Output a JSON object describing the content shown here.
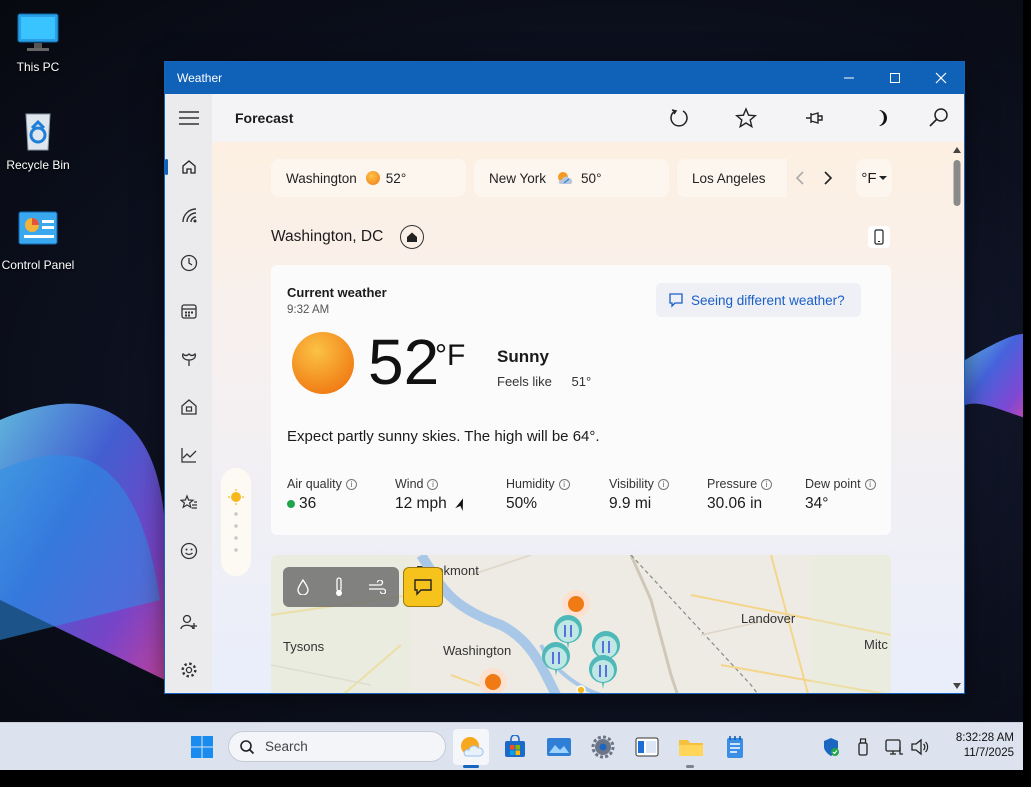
{
  "desktop": {
    "icons": [
      {
        "label": "This PC",
        "icon": "monitor-icon"
      },
      {
        "label": "Recycle Bin",
        "icon": "recycle-bin-icon"
      },
      {
        "label": "Control Panel",
        "icon": "control-panel-icon"
      }
    ]
  },
  "window": {
    "title": "Weather",
    "controls": [
      "minimize-icon",
      "maximize-icon",
      "close-icon"
    ]
  },
  "rail": {
    "items": [
      "menu-icon",
      "home-icon",
      "radar-icon",
      "clock-icon",
      "calendar-icon",
      "pollen-icon",
      "home-alt-icon",
      "chart-icon",
      "favorites-icon",
      "smiley-icon",
      "add-user-icon",
      "settings-icon"
    ]
  },
  "cmdbar": {
    "title": "Forecast",
    "buttons": [
      "refresh-icon",
      "star-icon",
      "pin-icon",
      "moon-icon",
      "search-icon"
    ]
  },
  "locations": [
    {
      "city": "Washington",
      "temp": "52°",
      "icon": "sun-icon"
    },
    {
      "city": "New York",
      "temp": "50°",
      "icon": "partly-cloudy-icon"
    },
    {
      "city": "Los Angeles",
      "temp": "",
      "icon": ""
    }
  ],
  "unit": "°F",
  "place": "Washington, DC",
  "current": {
    "header": "Current weather",
    "time": "9:32 AM",
    "feedback": "Seeing different weather?",
    "temp": "52",
    "temp_unit": "°F",
    "condition": "Sunny",
    "feels_label": "Feels like",
    "feels_value": "51°",
    "summary": "Expect partly sunny skies. The high will be 64°.",
    "accent": "#f08a1c"
  },
  "stats": [
    {
      "label": "Air quality",
      "value": "36"
    },
    {
      "label": "Wind",
      "value": "12 mph"
    },
    {
      "label": "Humidity",
      "value": "50%"
    },
    {
      "label": "Visibility",
      "value": "9.9 mi"
    },
    {
      "label": "Pressure",
      "value": "30.06 in"
    },
    {
      "label": "Dew point",
      "value": "34°"
    }
  ],
  "map": {
    "labels": [
      "Brookmont",
      "Tysons",
      "Washington",
      "Landover",
      "Mitc"
    ],
    "layers": [
      "precipitation-icon",
      "temperature-icon",
      "wind-icon",
      "comment-icon"
    ]
  },
  "taskbar": {
    "search_placeholder": "Search",
    "apps": [
      "weather-app-icon",
      "store-icon",
      "photos-icon",
      "settings-icon",
      "terminal-icon",
      "file-explorer-icon",
      "notepad-icon"
    ],
    "tray": [
      "security-icon",
      "usb-icon",
      "network-icon",
      "volume-icon"
    ],
    "time": "8:32:28 AM",
    "date": "11/7/2025"
  }
}
